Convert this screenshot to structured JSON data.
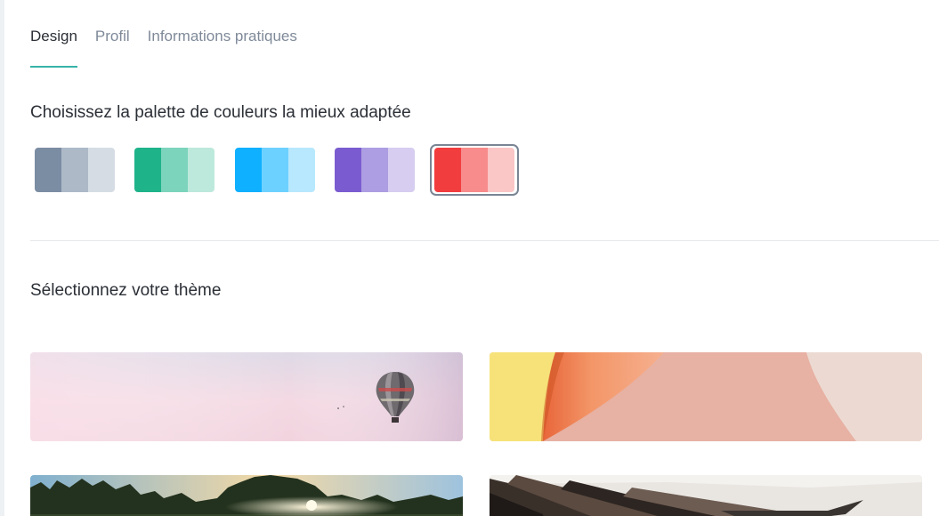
{
  "tabs": [
    {
      "label": "Design",
      "active": true
    },
    {
      "label": "Profil",
      "active": false
    },
    {
      "label": "Informations pratiques",
      "active": false
    }
  ],
  "palette_section": {
    "title": "Choisissez la palette de couleurs la mieux adaptée",
    "palettes": [
      {
        "name": "gris",
        "colors": [
          "#7b8da3",
          "#adb9c7",
          "#d5dce4"
        ],
        "selected": false
      },
      {
        "name": "vert",
        "colors": [
          "#1fb38a",
          "#7bd4bb",
          "#bde9dc"
        ],
        "selected": false
      },
      {
        "name": "bleu",
        "colors": [
          "#0fb0ff",
          "#6dd1ff",
          "#b7e8fd"
        ],
        "selected": false
      },
      {
        "name": "violet",
        "colors": [
          "#7a5cd0",
          "#ad9ee3",
          "#d6cdf0"
        ],
        "selected": false
      },
      {
        "name": "rouge",
        "colors": [
          "#f23d3f",
          "#f88b8b",
          "#fac6c6"
        ],
        "selected": true
      }
    ]
  },
  "theme_section": {
    "title": "Sélectionnez votre thème",
    "themes": [
      {
        "name": "balloon-sky"
      },
      {
        "name": "paper-curves"
      },
      {
        "name": "forest-sunset"
      },
      {
        "name": "paint-brushes"
      }
    ]
  },
  "accent_color": "#36b3a8"
}
